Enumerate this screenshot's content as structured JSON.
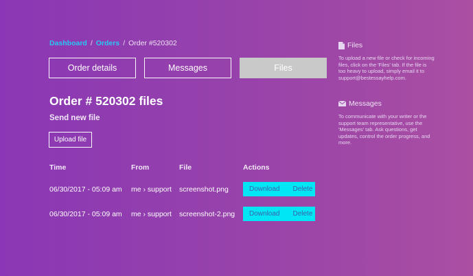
{
  "breadcrumb": {
    "dashboard": "Dashboard",
    "orders": "Orders",
    "separator": "/",
    "current": "Order #520302"
  },
  "tabs": [
    {
      "label": "Order details",
      "active": false
    },
    {
      "label": "Messages",
      "active": false
    },
    {
      "label": "Files",
      "active": true
    }
  ],
  "main": {
    "title": "Order # 520302 files",
    "send_new_file": "Send new file",
    "upload_label": "Upload file"
  },
  "table": {
    "headers": {
      "time": "Time",
      "from": "From",
      "file": "File",
      "actions": "Actions"
    },
    "rows": [
      {
        "time": "06/30/2017 - 05:09 am",
        "from": "me › support",
        "file": "screenshot.png",
        "download": "Download",
        "delete": "Delete"
      },
      {
        "time": "06/30/2017 - 05:09 am",
        "from": "me › support",
        "file": "screenshot-2.png",
        "download": "Download",
        "delete": "Delete"
      }
    ]
  },
  "sidebar": {
    "files": {
      "title": "Files",
      "icon": "file-icon",
      "text": "To upload a new file or check for incoming files, click on the 'Files' tab. If the file is too heavy to upload, simply email it to support@bestessayhelp.com."
    },
    "messages": {
      "title": "Messages",
      "icon": "envelope-icon",
      "text": "To communicate with your writer or the support team representative, use the 'Messages' tab. Ask questions, get updates, control the order progress, and more."
    }
  },
  "colors": {
    "link": "#29c7f4",
    "action_bg": "#00e6f5",
    "action_text": "#3e5fa8",
    "active_tab": "#c9c9c9"
  }
}
